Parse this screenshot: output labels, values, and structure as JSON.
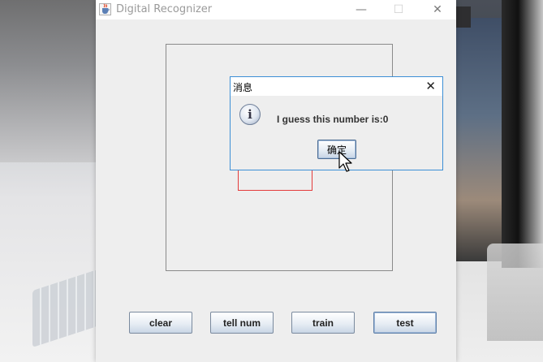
{
  "window": {
    "title": "Digital Recognizer",
    "controls": {
      "minimize": "—",
      "maximize": "☐",
      "close": "✕"
    },
    "app_icon": "java-cup-icon"
  },
  "buttons": {
    "clear": "clear",
    "tell_num": "tell num",
    "train": "train",
    "test": "test"
  },
  "dialog": {
    "title": "消息",
    "close": "✕",
    "icon": "info-icon",
    "icon_glyph": "i",
    "message": "I guess this number is:0",
    "ok": "确定"
  },
  "colors": {
    "bbox": "#e33b3b",
    "dialog_border": "#3c8fd6",
    "window_bg": "#eeeeee"
  }
}
